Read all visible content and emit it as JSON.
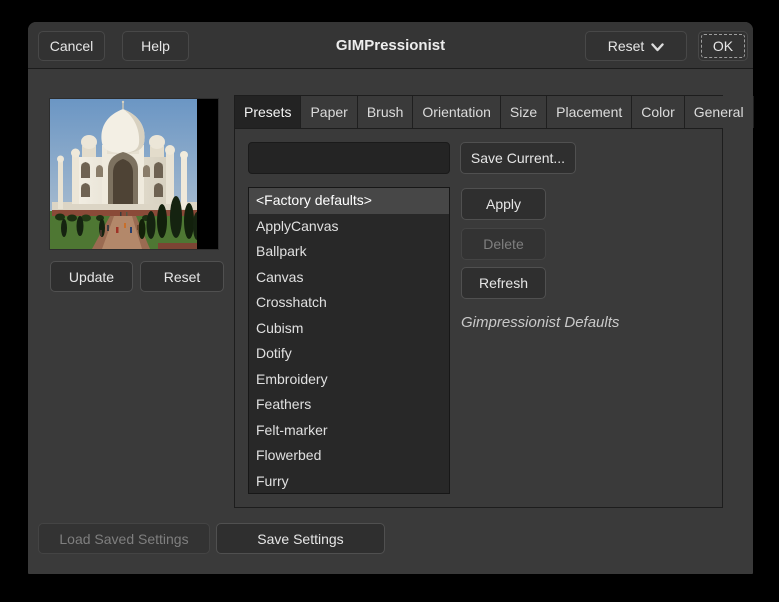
{
  "window": {
    "title": "GIMPressionist"
  },
  "header": {
    "cancel": "Cancel",
    "help": "Help",
    "reset": "Reset",
    "ok": "OK",
    "icons": {
      "reset_dropdown": "chevron-down"
    }
  },
  "preview_panel": {
    "image": "taj-mahal-photo-preview",
    "update": "Update",
    "reset": "Reset"
  },
  "notebook": {
    "tabs": [
      {
        "label": "Presets",
        "active": true
      },
      {
        "label": "Paper"
      },
      {
        "label": "Brush"
      },
      {
        "label": "Orientation"
      },
      {
        "label": "Size"
      },
      {
        "label": "Placement"
      },
      {
        "label": "Color"
      },
      {
        "label": "General"
      }
    ]
  },
  "presets_tab": {
    "preset_name_input": {
      "value": "",
      "placeholder": ""
    },
    "save_current": "Save Current...",
    "presets_list": [
      "<Factory defaults>",
      "ApplyCanvas",
      "Ballpark",
      "Canvas",
      "Crosshatch",
      "Cubism",
      "Dotify",
      "Embroidery",
      "Feathers",
      "Felt-marker",
      "Flowerbed",
      "Furry"
    ],
    "selected_index": 0,
    "apply": "Apply",
    "delete": {
      "label": "Delete",
      "disabled": true
    },
    "refresh": "Refresh",
    "description": "Gimpressionist Defaults"
  },
  "footer": {
    "load_saved": {
      "label": "Load Saved Settings",
      "disabled": true
    },
    "save_settings": "Save Settings"
  },
  "colors": {
    "window_backdrop": "#000000",
    "dialog_bg": "#3a3a3a",
    "header_bg": "#353535",
    "button_bg": "#2f2f2f",
    "button_border": "#505050",
    "entry_bg": "#242424",
    "list_bg": "#282828",
    "selected_row_bg": "#474747",
    "active_tab_bg": "#232323",
    "text": "#e6e6e6",
    "disabled_text": "#7f7f7f"
  }
}
